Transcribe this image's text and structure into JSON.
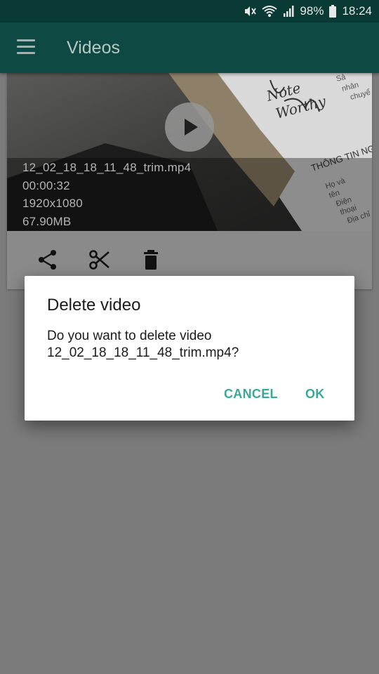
{
  "status_bar": {
    "battery": "98%",
    "time": "18:24",
    "icons": [
      "mute-icon",
      "wifi-icon",
      "signal-icon",
      "battery-icon"
    ]
  },
  "app_bar": {
    "title": "Videos",
    "menu_icon": "hamburger-menu-icon"
  },
  "video_card": {
    "filename": "12_02_18_18_11_48_trim.mp4",
    "duration": "00:00:32",
    "resolution": "1920x1080",
    "size": "67.90MB",
    "thumbnail_text": {
      "note": "Note",
      "worthy": "Worthy",
      "heading": "THÔNG TIN NG",
      "labels": [
        "Họ và",
        "tên",
        "Điện",
        "thoại",
        "Địa chỉ"
      ],
      "top_right": [
        "Sả",
        "nhân",
        "chuyể"
      ]
    },
    "actions": [
      "share-icon",
      "scissors-icon",
      "trash-icon"
    ]
  },
  "dialog": {
    "title": "Delete video",
    "message_line1": "Do you want to delete video",
    "message_line2": "12_02_18_18_11_48_trim.mp4?",
    "cancel_label": "CANCEL",
    "ok_label": "OK"
  },
  "colors": {
    "status_bar": "#0a3a35",
    "app_bar": "#0e4a43",
    "accent": "#3aa897",
    "scrim": "#7b7b7b"
  }
}
